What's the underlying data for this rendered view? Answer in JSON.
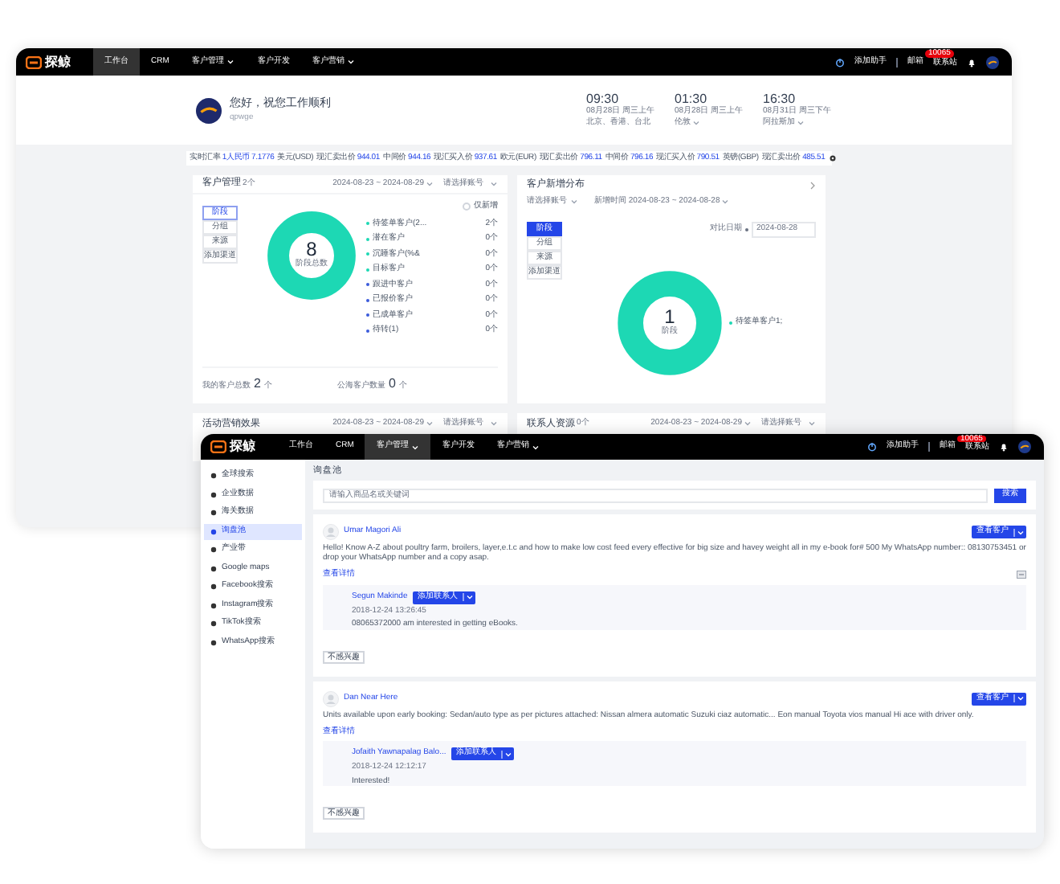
{
  "back_window": {
    "nav": {
      "logo": "探鲸",
      "items": [
        {
          "label": "工作台",
          "selected": true,
          "dropdown": false
        },
        {
          "label": "CRM",
          "selected": false,
          "dropdown": false
        },
        {
          "label": "客户管理",
          "selected": false,
          "dropdown": true
        },
        {
          "label": "客户开发",
          "selected": false,
          "dropdown": false
        },
        {
          "label": "客户营销",
          "selected": false,
          "dropdown": true
        }
      ],
      "assistant": "添加助手",
      "mail": "邮箱",
      "badge": "10065",
      "contacts": "联系站"
    },
    "greeting": "您好，祝您工作顺利",
    "username": "qpwge",
    "clocks": [
      {
        "time": "09:30",
        "date": "08月28日 周三上午",
        "place": "北京、香港、台北",
        "dropdown": false
      },
      {
        "time": "01:30",
        "date": "08月28日 周三上午",
        "place": "伦敦",
        "dropdown": true
      },
      {
        "time": "16:30",
        "date": "08月31日 周三下午",
        "place": "阿拉斯加",
        "dropdown": true
      }
    ],
    "rates": [
      {
        "label": "实时汇率",
        "value": "1人民币 7.1776"
      },
      {
        "label": "美元(USD)"
      },
      {
        "label": "现汇卖出价",
        "value": "944.01"
      },
      {
        "label": "中间价",
        "value": "944.16"
      },
      {
        "label": "现汇买入价",
        "value": "937.61"
      },
      {
        "label": "欧元(EUR)"
      },
      {
        "label": "现汇卖出价",
        "value": "796.11"
      },
      {
        "label": "中间价",
        "value": "796.16"
      },
      {
        "label": "现汇买入价",
        "value": "790.51"
      },
      {
        "label": "英镑(GBP)"
      },
      {
        "label": "现汇卖出价",
        "value": "485.51"
      }
    ],
    "customer_card": {
      "title": "客户管理",
      "count": "2个",
      "date_range": "2024-08-23 ~ 2024-08-29",
      "account": "请选择账号",
      "tabs": [
        {
          "label": "阶段",
          "selected": true
        },
        {
          "label": "分组",
          "selected": false
        },
        {
          "label": "来源",
          "selected": false
        },
        {
          "label": "添加渠道",
          "selected": false
        }
      ],
      "only_new": {
        "label": "仅新增",
        "checked": false
      },
      "total": "8",
      "total_label": "阶段总数",
      "legend": [
        {
          "label": "待签单客户(2...",
          "value": "2个",
          "color": "#1dd8b4"
        },
        {
          "label": "潜在客户",
          "value": "0个",
          "color": "#1dd8b4"
        },
        {
          "label": "沉睡客户(%&",
          "value": "0个",
          "color": "#1dd8b4"
        },
        {
          "label": "目标客户",
          "value": "0个",
          "color": "#1dd8b4"
        },
        {
          "label": "跟进中客户",
          "value": "0个",
          "color": "#3b5bdb"
        },
        {
          "label": "已报价客户",
          "value": "0个",
          "color": "#3b5bdb"
        },
        {
          "label": "已成单客户",
          "value": "0个",
          "color": "#3b5bdb"
        },
        {
          "label": "待转(1)",
          "value": "0个",
          "color": "#3b5bdb"
        }
      ],
      "footer": [
        {
          "label": "我的客户总数",
          "value": "2",
          "unit": "个"
        },
        {
          "label": "公海客户数量",
          "value": "0",
          "unit": "个"
        }
      ]
    },
    "growth_card": {
      "title": "客户新增分布",
      "account": "请选择账号",
      "time_label": "新增时间",
      "date_range": "2024-08-23 ~ 2024-08-28",
      "tabs": [
        {
          "label": "阶段",
          "selected": true
        },
        {
          "label": "分组",
          "selected": false
        },
        {
          "label": "来源",
          "selected": false
        },
        {
          "label": "添加渠道",
          "selected": false
        }
      ],
      "compare_label": "对比日期",
      "compare_date": "2024-08-28",
      "total": "1",
      "total_label": "阶段",
      "legend": [
        {
          "label": "待签单客户1;",
          "color": "#1dd8b4"
        }
      ]
    },
    "lower_cards": [
      {
        "title": "活动营销效果",
        "date_range": "2024-08-23 ~ 2024-08-29",
        "account": "请选择账号"
      },
      {
        "title": "联系人资源",
        "count": "0个",
        "date_range": "2024-08-23 ~ 2024-08-29",
        "account": "请选择账号"
      }
    ]
  },
  "front_window": {
    "nav": {
      "logo": "探鲸",
      "items": [
        {
          "label": "工作台",
          "selected": false,
          "dropdown": false
        },
        {
          "label": "CRM",
          "selected": false,
          "dropdown": false
        },
        {
          "label": "客户管理",
          "selected": true,
          "dropdown": true
        },
        {
          "label": "客户开发",
          "selected": false,
          "dropdown": false
        },
        {
          "label": "客户营销",
          "selected": false,
          "dropdown": true
        }
      ],
      "assistant": "添加助手",
      "mail": "邮箱",
      "badge": "10065",
      "contacts": "联系站"
    },
    "sidebar": [
      {
        "label": "全球搜索",
        "selected": false
      },
      {
        "label": "企业数据",
        "selected": false
      },
      {
        "label": "海关数据",
        "selected": false
      },
      {
        "label": "询盘池",
        "selected": true
      },
      {
        "label": "产业带",
        "selected": false
      },
      {
        "label": "Google maps",
        "selected": false
      },
      {
        "label": "Facebook搜索",
        "selected": false
      },
      {
        "label": "Instagram搜索",
        "selected": false
      },
      {
        "label": "TikTok搜索",
        "selected": false
      },
      {
        "label": "WhatsApp搜索",
        "selected": false
      }
    ],
    "title": "询盘池",
    "search": {
      "placeholder": "请输入商品名或关键词",
      "button": "搜索"
    },
    "posts": [
      {
        "author": "Umar Magori Ali",
        "button": "查看客户",
        "text": "Hello! Know A-Z about poultry farm, broilers, layer,e.t.c and how to make low cost feed every effective for big size and havey weight all in my e-book for# 500 My WhatsApp number:: 08130753451 or drop your WhatsApp number and a copy asap.",
        "details": "查看详情",
        "reply": {
          "name": "Segun Makinde",
          "button": "添加联系人",
          "time": "2018-12-24 13:26:45",
          "text": "08065372000 am interested in getting eBooks."
        },
        "dismiss": "不感兴趣"
      },
      {
        "author": "Dan Near Here",
        "button": "查看客户",
        "text": "Units available upon early booking: Sedan/auto type as per pictures attached: Nissan almera automatic Suzuki ciaz automatic... Eon manual Toyota vios manual Hi ace with driver only.",
        "details": "查看详情",
        "reply": {
          "name": "Jofaith Yawnapalag Balo...",
          "button": "添加联系人",
          "time": "2018-12-24 12:12:17",
          "text": "Interested!"
        },
        "dismiss": "不感兴趣"
      }
    ]
  }
}
